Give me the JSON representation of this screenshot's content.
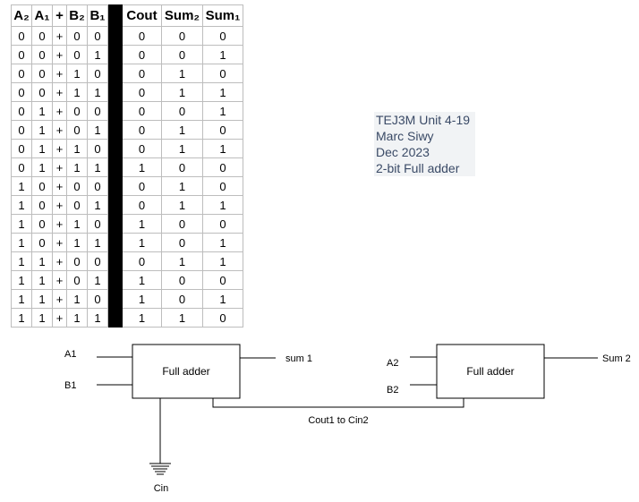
{
  "truth_table": {
    "headers": [
      "A₂",
      "A₁",
      "+",
      "B₂",
      "B₁",
      "",
      "Cout",
      "Sum₂",
      "Sum₁"
    ],
    "rows": [
      [
        "0",
        "0",
        "+",
        "0",
        "0",
        "",
        "0",
        "0",
        "0"
      ],
      [
        "0",
        "0",
        "+",
        "0",
        "1",
        "",
        "0",
        "0",
        "1"
      ],
      [
        "0",
        "0",
        "+",
        "1",
        "0",
        "",
        "0",
        "1",
        "0"
      ],
      [
        "0",
        "0",
        "+",
        "1",
        "1",
        "",
        "0",
        "1",
        "1"
      ],
      [
        "0",
        "1",
        "+",
        "0",
        "0",
        "",
        "0",
        "0",
        "1"
      ],
      [
        "0",
        "1",
        "+",
        "0",
        "1",
        "",
        "0",
        "1",
        "0"
      ],
      [
        "0",
        "1",
        "+",
        "1",
        "0",
        "",
        "0",
        "1",
        "1"
      ],
      [
        "0",
        "1",
        "+",
        "1",
        "1",
        "",
        "1",
        "0",
        "0"
      ],
      [
        "1",
        "0",
        "+",
        "0",
        "0",
        "",
        "0",
        "1",
        "0"
      ],
      [
        "1",
        "0",
        "+",
        "0",
        "1",
        "",
        "0",
        "1",
        "1"
      ],
      [
        "1",
        "0",
        "+",
        "1",
        "0",
        "",
        "1",
        "0",
        "0"
      ],
      [
        "1",
        "0",
        "+",
        "1",
        "1",
        "",
        "1",
        "0",
        "1"
      ],
      [
        "1",
        "1",
        "+",
        "0",
        "0",
        "",
        "0",
        "1",
        "1"
      ],
      [
        "1",
        "1",
        "+",
        "0",
        "1",
        "",
        "1",
        "0",
        "0"
      ],
      [
        "1",
        "1",
        "+",
        "1",
        "0",
        "",
        "1",
        "0",
        "1"
      ],
      [
        "1",
        "1",
        "+",
        "1",
        "1",
        "",
        "1",
        "1",
        "0"
      ]
    ]
  },
  "info": {
    "line1": "TEJ3M Unit 4-19",
    "line2": "Marc Siwy",
    "line3": "Dec 2023",
    "line4": "2-bit Full adder"
  },
  "circuit": {
    "adder1": {
      "label": "Full adder",
      "in1": "A1",
      "in2": "B1",
      "out": "sum 1"
    },
    "adder2": {
      "label": "Full adder",
      "in1": "A2",
      "in2": "B2",
      "out": "Sum 2"
    },
    "link_label": "Cout1 to Cin2",
    "ground_label": "Cin"
  }
}
